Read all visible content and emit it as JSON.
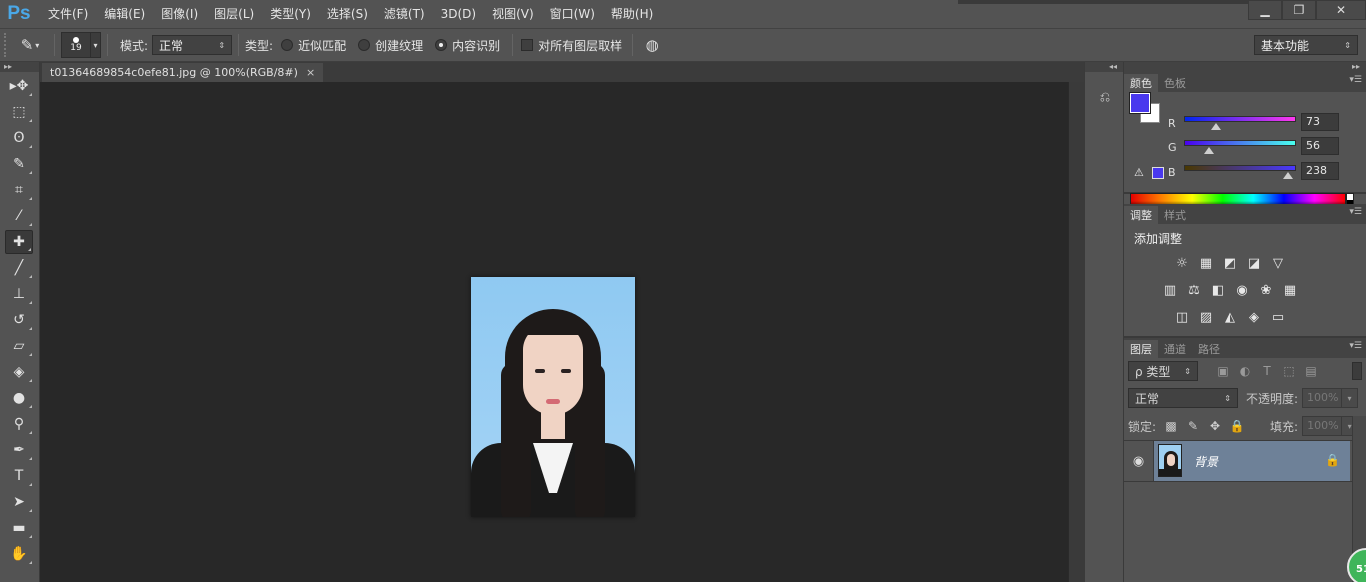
{
  "app": {
    "logo": "Ps"
  },
  "menu": [
    "文件(F)",
    "编辑(E)",
    "图像(I)",
    "图层(L)",
    "类型(Y)",
    "选择(S)",
    "滤镜(T)",
    "3D(D)",
    "视图(V)",
    "窗口(W)",
    "帮助(H)"
  ],
  "window_controls": {
    "minimize": "▁",
    "restore": "❐",
    "close": "✕"
  },
  "options": {
    "tool_icon": "spot-healing-brush-icon",
    "brush_size": "19",
    "mode_label": "模式:",
    "mode_value": "正常",
    "type_label": "类型:",
    "type_options": [
      {
        "label": "近似匹配",
        "checked": false
      },
      {
        "label": "创建纹理",
        "checked": false
      },
      {
        "label": "内容识别",
        "checked": true
      }
    ],
    "sample_all_label": "对所有图层取样",
    "pressure_icon": "pressure-size-icon",
    "workspace": "基本功能"
  },
  "toolbar": {
    "tools": [
      {
        "name": "move-tool-icon",
        "glyph": "▸✥",
        "active": false
      },
      {
        "name": "marquee-tool-icon",
        "glyph": "⬚",
        "active": false
      },
      {
        "name": "lasso-tool-icon",
        "glyph": "ʘ",
        "active": false
      },
      {
        "name": "quick-selection-tool-icon",
        "glyph": "✎",
        "active": false
      },
      {
        "name": "crop-tool-icon",
        "glyph": "⌗",
        "active": false
      },
      {
        "name": "eyedropper-tool-icon",
        "glyph": "⁄",
        "active": false
      },
      {
        "name": "spot-healing-brush-tool-icon",
        "glyph": "✚",
        "active": true
      },
      {
        "name": "brush-tool-icon",
        "glyph": "╱",
        "active": false
      },
      {
        "name": "clone-stamp-tool-icon",
        "glyph": "⊥",
        "active": false
      },
      {
        "name": "history-brush-tool-icon",
        "glyph": "↺",
        "active": false
      },
      {
        "name": "eraser-tool-icon",
        "glyph": "▱",
        "active": false
      },
      {
        "name": "paint-bucket-tool-icon",
        "glyph": "◈",
        "active": false
      },
      {
        "name": "blur-tool-icon",
        "glyph": "●",
        "active": false
      },
      {
        "name": "dodge-tool-icon",
        "glyph": "⚲",
        "active": false
      },
      {
        "name": "pen-tool-icon",
        "glyph": "✒",
        "active": false
      },
      {
        "name": "type-tool-icon",
        "glyph": "T",
        "active": false
      },
      {
        "name": "path-selection-tool-icon",
        "glyph": "➤",
        "active": false
      },
      {
        "name": "rectangle-tool-icon",
        "glyph": "▬",
        "active": false
      },
      {
        "name": "hand-tool-icon",
        "glyph": "✋",
        "active": false
      }
    ]
  },
  "document": {
    "tab_title": "t01364689854c0efe81.jpg @ 100%(RGB/8#)",
    "close": "×"
  },
  "color_panel": {
    "tabs": [
      "颜色",
      "色板"
    ],
    "foreground": "#4938ee",
    "background": "#ffffff",
    "channels": [
      {
        "label": "R",
        "value": "73",
        "fraction": 0.286,
        "gradient": "linear-gradient(90deg,#0026ee,#ff38ee)"
      },
      {
        "label": "G",
        "value": "56",
        "fraction": 0.22,
        "gradient": "linear-gradient(90deg,#4900ee,#49ffee)"
      },
      {
        "label": "B",
        "value": "238",
        "fraction": 0.933,
        "gradient": "linear-gradient(90deg,#493800,#4938ff)"
      }
    ]
  },
  "adjustments_panel": {
    "tabs": [
      "调整",
      "样式"
    ],
    "title": "添加调整",
    "rows": [
      [
        "brightness-contrast-icon",
        "levels-icon",
        "curves-icon",
        "exposure-icon",
        "vibrance-icon"
      ],
      [
        "hue-saturation-icon",
        "color-balance-icon",
        "black-white-icon",
        "photo-filter-icon",
        "channel-mixer-icon",
        "color-lookup-icon"
      ],
      [
        "invert-icon",
        "posterize-icon",
        "threshold-icon",
        "selective-color-icon",
        "gradient-map-icon"
      ]
    ],
    "glyphs": [
      [
        "☼",
        "▦",
        "◩",
        "◪",
        "▽"
      ],
      [
        "▥",
        "⚖",
        "◧",
        "◉",
        "❀",
        "▦"
      ],
      [
        "◫",
        "▨",
        "◭",
        "◈",
        "▭"
      ]
    ]
  },
  "layers_panel": {
    "tabs": [
      "图层",
      "通道",
      "路径"
    ],
    "filter_label": "ρ 类型",
    "filter_icons": [
      "image-filter-icon",
      "adjustment-filter-icon",
      "type-filter-icon",
      "shape-filter-icon",
      "smart-object-filter-icon"
    ],
    "filter_glyphs": [
      "▣",
      "◐",
      "T",
      "⬚",
      "▤"
    ],
    "blend_mode": "正常",
    "opacity_label": "不透明度:",
    "opacity": "100%",
    "lock_label": "锁定:",
    "lock_icons": [
      "lock-transparent-icon",
      "lock-pixels-icon",
      "lock-position-icon",
      "lock-all-icon"
    ],
    "lock_glyphs": [
      "▩",
      "✎",
      "✥",
      "🔒"
    ],
    "fill_label": "填充:",
    "fill": "100%",
    "layers": [
      {
        "name": "背景",
        "visible": true,
        "locked": true
      }
    ]
  },
  "badge": {
    "text": "51"
  }
}
